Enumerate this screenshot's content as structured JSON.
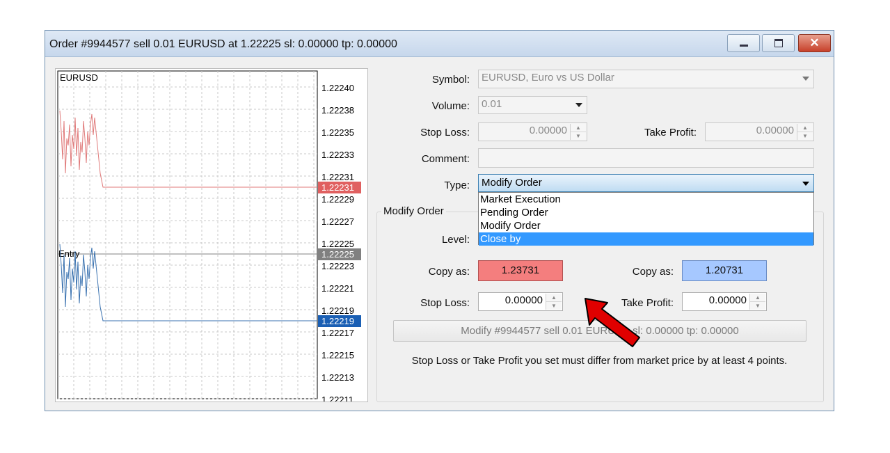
{
  "window": {
    "title": "Order #9944577 sell 0.01 EURUSD at 1.22225 sl: 0.00000 tp: 0.00000",
    "minimize_icon": "minimize-icon",
    "maximize_icon": "maximize-icon",
    "close_icon": "close-icon",
    "close_glyph": "✕"
  },
  "chart": {
    "symbol_label": "EURUSD",
    "entry_label": "Entry",
    "price_axis": [
      "1.22240",
      "1.22238",
      "1.22235",
      "1.22233",
      "1.22231",
      "1.22229",
      "1.22227",
      "1.22225",
      "1.22223",
      "1.22221",
      "1.22219",
      "1.22217",
      "1.22215",
      "1.22213",
      "1.22211"
    ],
    "ask_price": "1.22231",
    "entry_price": "1.22225",
    "bid_price": "1.22219",
    "colors": {
      "ask": "#e06060",
      "bid": "#1a5fb4",
      "entry": "#808080",
      "ask_line": "#e07a7a",
      "bid_line": "#3a72b0"
    }
  },
  "form": {
    "symbol_label": "Symbol:",
    "symbol_value": "EURUSD, Euro vs US Dollar",
    "volume_label": "Volume:",
    "volume_value": "0.01",
    "stoploss_label": "Stop Loss:",
    "stoploss_value": "0.00000",
    "takeprofit_label": "Take Profit:",
    "takeprofit_value": "0.00000",
    "comment_label": "Comment:",
    "comment_value": "",
    "type_label": "Type:",
    "type_value": "Modify Order",
    "type_options": [
      "Market Execution",
      "Pending Order",
      "Modify Order",
      "Close by"
    ],
    "type_highlighted": "Close by"
  },
  "modify_group": {
    "title": "Modify Order",
    "level_label": "Level:",
    "copy_as_label_left": "Copy as:",
    "copy_as_value_left": "1.23731",
    "copy_as_label_right": "Copy as:",
    "copy_as_value_right": "1.20731",
    "stoploss_label": "Stop Loss:",
    "stoploss_value": "0.00000",
    "takeprofit_label": "Take Profit:",
    "takeprofit_value": "0.00000",
    "modify_button": "Modify #9944577 sell 0.01 EURUSD sl: 0.00000 tp: 0.00000",
    "note": "Stop Loss or Take Profit you set must differ from market price by at least 4 points.",
    "colors": {
      "copy_left_bg": "#f47e7e",
      "copy_right_bg": "#a6c8ff",
      "arrow": "#e00000"
    }
  }
}
